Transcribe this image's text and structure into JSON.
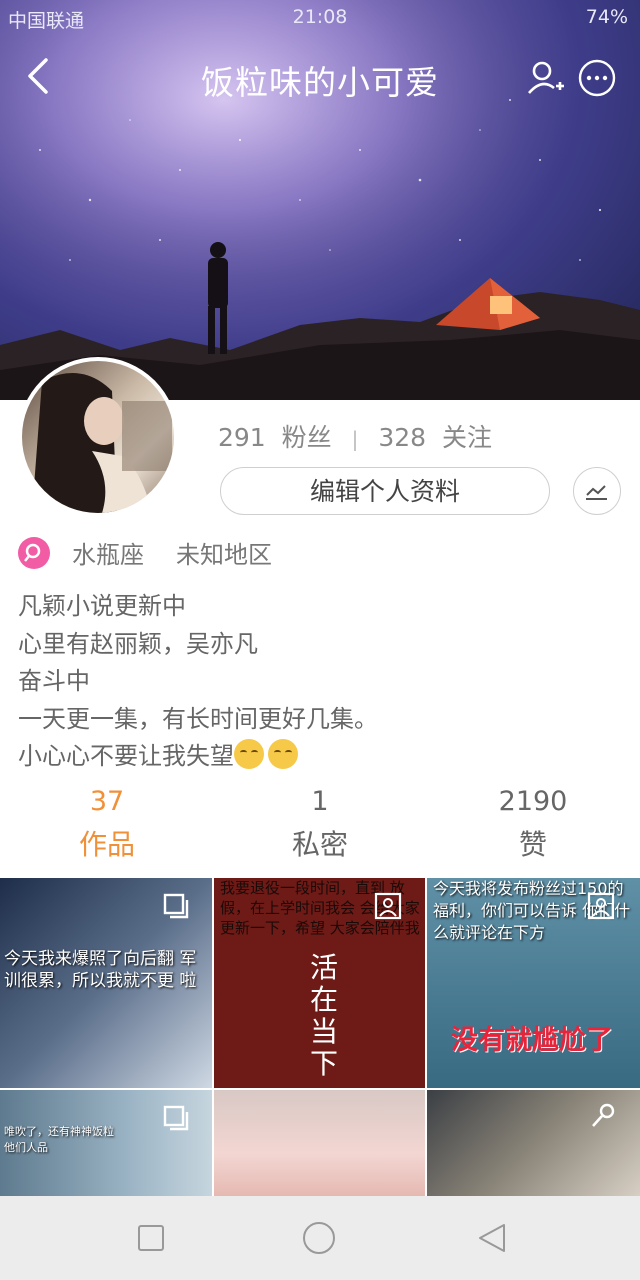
{
  "status_bar": {
    "carrier": "中国联通",
    "time": "21:08",
    "battery": "74%"
  },
  "header": {
    "title": "饭粒味的小可爱"
  },
  "profile": {
    "followers_count": "291",
    "followers_label": "粉丝",
    "following_count": "328",
    "following_label": "关注",
    "separator": "|",
    "edit_button": "编辑个人资料",
    "zodiac": "水瓶座",
    "location": "未知地区",
    "bio": [
      "凡颖小说更新中",
      "心里有赵丽颖，吴亦凡",
      "奋斗中",
      "一天更一集，有长时间更好几集。",
      "小心心不要让我失望"
    ]
  },
  "tabs": [
    {
      "count": "37",
      "label": "作品"
    },
    {
      "count": "1",
      "label": "私密"
    },
    {
      "count": "2190",
      "label": "赞"
    }
  ],
  "grid": {
    "cell1_caption": "今天我来爆照了向后翻 军训很累，所以我就不更 啦",
    "cell2_top": "我要退役一段时间，直到 放假，在上学时间我会 会给大家更新一下，希望 大家会陪伴我",
    "cell2_calligraphy": "活在当下",
    "cell3_top": "今天我将发布粉丝过150的福利，你们可以告诉 你们什么就评论在下方",
    "cell3_red": "没有就尴尬了",
    "cell4_caption": "唯吹了，还有神神饭粒 他们人品"
  },
  "colors": {
    "accent": "#f0913a",
    "gender": "#f25ca5"
  }
}
